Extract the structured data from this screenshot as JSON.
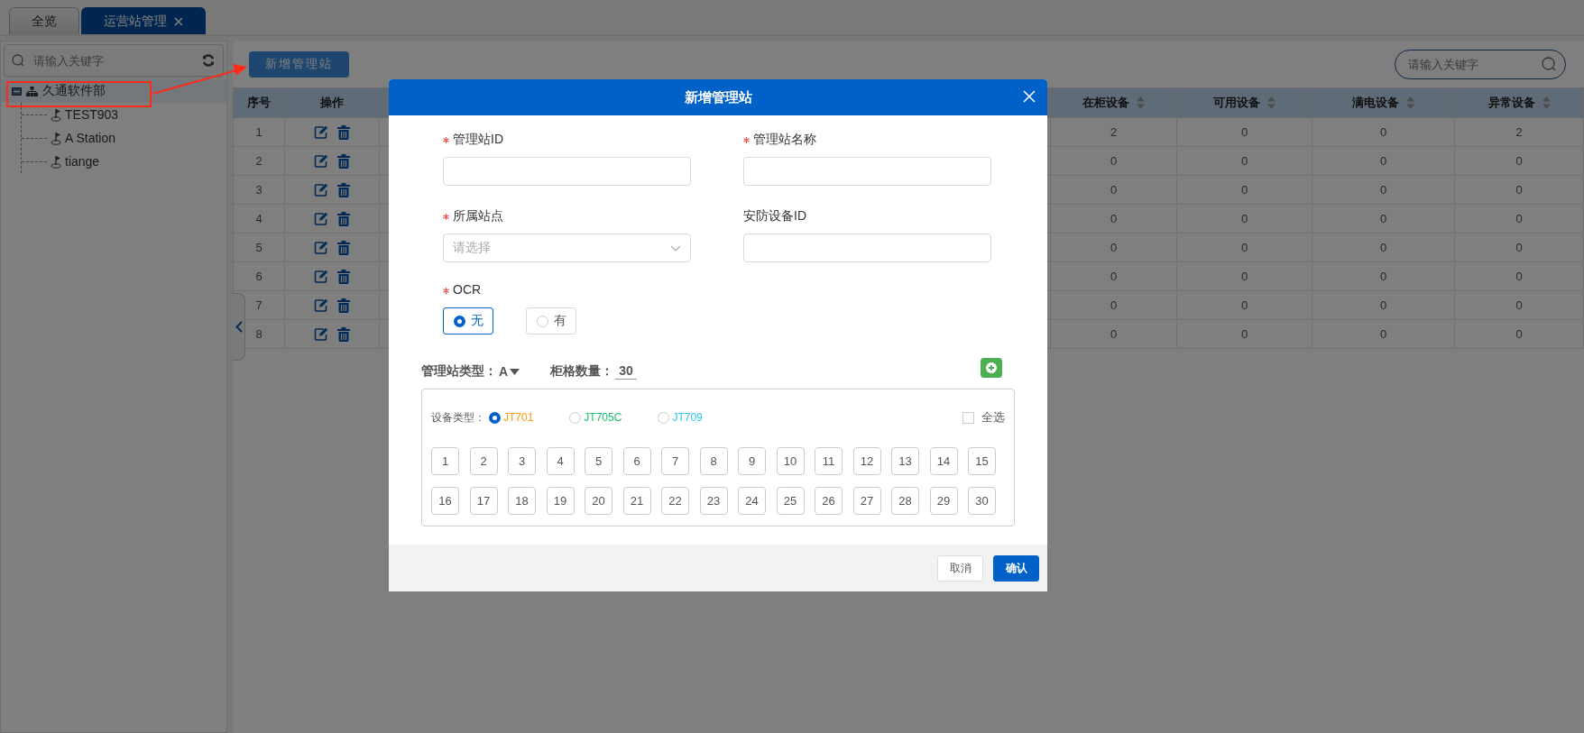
{
  "tabs": [
    {
      "label": "全览",
      "selected": false,
      "closable": false
    },
    {
      "label": "运营站管理",
      "selected": true,
      "closable": true
    }
  ],
  "sidebar": {
    "search": {
      "placeholder": "请输入关键字"
    },
    "tree": [
      {
        "label": "久通软件部",
        "expanded": true,
        "selected": true,
        "children": [
          {
            "label": "TEST903"
          },
          {
            "label": "A Station"
          },
          {
            "label": "tiange"
          }
        ]
      }
    ]
  },
  "toolbar": {
    "add_button": "新增管理站",
    "search": {
      "placeholder": "请输入关键字"
    }
  },
  "table": {
    "columns": [
      {
        "label": "序号",
        "kind": "plain"
      },
      {
        "label": "操作",
        "kind": "actions"
      },
      {
        "kind": "covered"
      },
      {
        "label": "在柜设备",
        "kind": "sortable"
      },
      {
        "label": "可用设备",
        "kind": "sortable"
      },
      {
        "label": "满电设备",
        "kind": "sortable"
      },
      {
        "label": "异常设备",
        "kind": "sortable"
      }
    ],
    "rows": [
      {
        "cells": [
          "1",
          "",
          "",
          "2",
          "0",
          "0",
          "2"
        ]
      },
      {
        "cells": [
          "2",
          "",
          "",
          "0",
          "0",
          "0",
          "0"
        ]
      },
      {
        "cells": [
          "3",
          "",
          "",
          "0",
          "0",
          "0",
          "0"
        ]
      },
      {
        "cells": [
          "4",
          "",
          "",
          "0",
          "0",
          "0",
          "0"
        ]
      },
      {
        "cells": [
          "5",
          "",
          "",
          "0",
          "0",
          "0",
          "0"
        ]
      },
      {
        "cells": [
          "6",
          "",
          "",
          "0",
          "0",
          "0",
          "0"
        ]
      },
      {
        "cells": [
          "7",
          "",
          "",
          "0",
          "0",
          "0",
          "0"
        ]
      },
      {
        "cells": [
          "8",
          "",
          "",
          "0",
          "0",
          "0",
          "0"
        ]
      }
    ]
  },
  "dialog": {
    "title": "新增管理站",
    "fields": [
      {
        "label": "管理站ID",
        "required": true,
        "kind": "text"
      },
      {
        "label": "管理站名称",
        "required": true,
        "kind": "text"
      },
      {
        "label": "所属站点",
        "required": true,
        "kind": "select",
        "placeholder": "请选择"
      },
      {
        "label": "安防设备ID",
        "required": false,
        "kind": "text"
      }
    ],
    "ocr": {
      "label": "OCR",
      "required": true,
      "options": [
        {
          "label": "无",
          "selected": true
        },
        {
          "label": "有",
          "selected": false
        }
      ]
    },
    "station_type": {
      "label": "管理站类型：",
      "value": "A"
    },
    "cabinet_count": {
      "label": "柜格数量：",
      "value": "30"
    },
    "device_types": {
      "label": "设备类型：",
      "options": [
        {
          "label": "JT701",
          "selected": true,
          "color": "#ff9900"
        },
        {
          "label": "JT705C",
          "selected": false,
          "color": "#19be6b"
        },
        {
          "label": "JT709",
          "selected": false,
          "color": "#2dc8f0"
        }
      ]
    },
    "select_all": {
      "label": "全选",
      "checked": false
    },
    "slots": [
      "1",
      "2",
      "3",
      "4",
      "5",
      "6",
      "7",
      "8",
      "9",
      "10",
      "11",
      "12",
      "13",
      "14",
      "15",
      "16",
      "17",
      "18",
      "19",
      "20",
      "21",
      "22",
      "23",
      "24",
      "25",
      "26",
      "27",
      "28",
      "29",
      "30"
    ],
    "buttons": [
      {
        "label": "取消",
        "kind": "secondary"
      },
      {
        "label": "确认",
        "kind": "primary"
      }
    ]
  }
}
